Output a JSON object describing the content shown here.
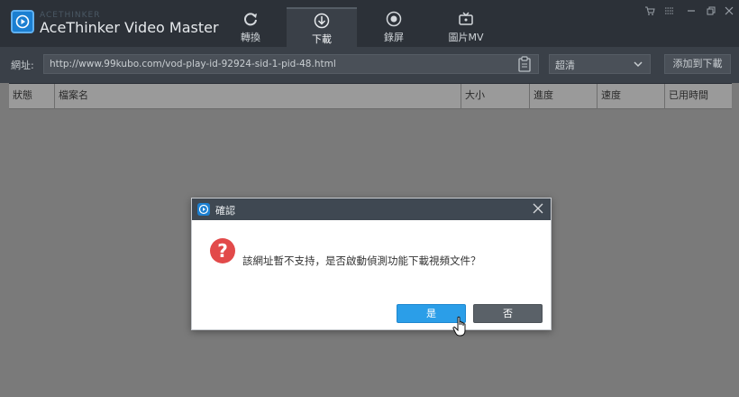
{
  "app": {
    "brand_small": "ACETHINKER",
    "title": "AceThinker Video Master"
  },
  "tabs": [
    {
      "label": "轉換",
      "icon": "refresh-icon"
    },
    {
      "label": "下載",
      "icon": "download-icon"
    },
    {
      "label": "錄屏",
      "icon": "record-icon"
    },
    {
      "label": "圖片MV",
      "icon": "tv-icon"
    }
  ],
  "active_tab": "下載",
  "window_controls": [
    "cart-icon",
    "menu-icon",
    "minimize-icon",
    "restore-icon",
    "close-icon"
  ],
  "urlbar": {
    "label": "網址:",
    "value": "http://www.99kubo.com/vod-play-id-92924-sid-1-pid-48.html",
    "quality_value": "超清",
    "add_label": "添加到下載"
  },
  "table": {
    "columns": [
      "狀態",
      "檔案名",
      "大小",
      "進度",
      "速度",
      "已用時間"
    ]
  },
  "dialog": {
    "title": "確認",
    "message": "該網址暫不支持，是否啟動偵測功能下載視頻文件？",
    "yes_label": "是",
    "no_label": "否",
    "question_mark": "?"
  },
  "colors": {
    "accent": "#2b9ee8",
    "titlebar": "#2c3138",
    "error": "#e24a4a"
  }
}
